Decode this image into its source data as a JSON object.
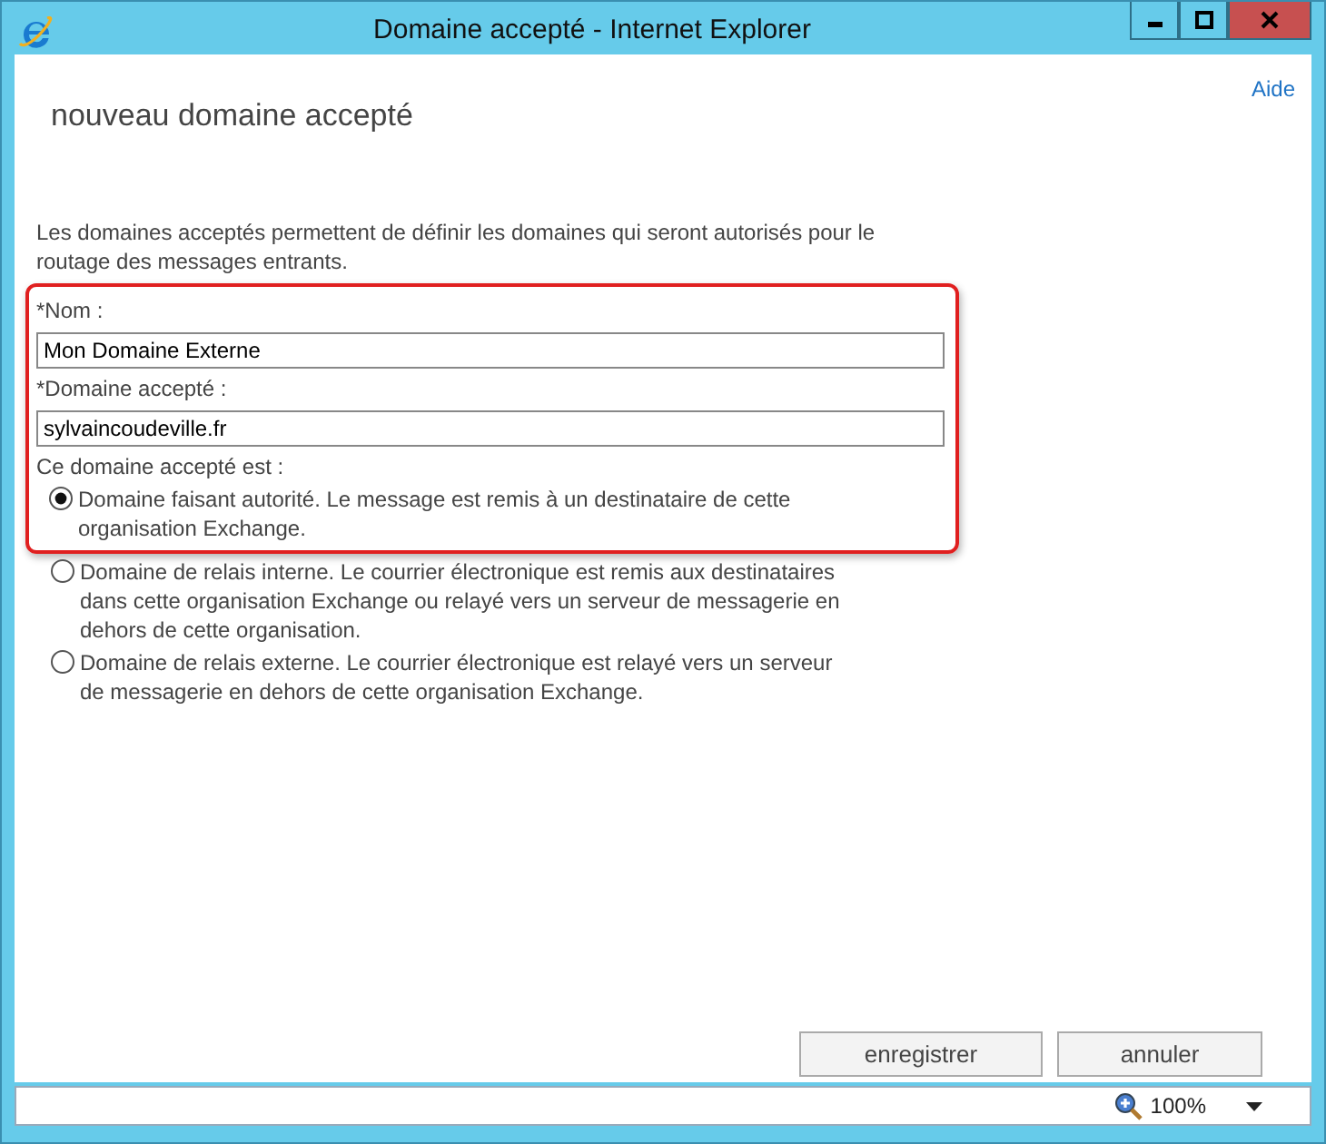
{
  "window": {
    "title": "Domaine accepté - Internet Explorer"
  },
  "help_link": "Aide",
  "heading": "nouveau domaine accepté",
  "description": "Les domaines acceptés permettent de définir les domaines qui seront autorisés pour le routage des messages entrants.",
  "fields": [
    {
      "label": "*Nom :",
      "value": "Mon Domaine Externe"
    },
    {
      "label": "*Domaine accepté :",
      "value": "sylvaincoudeville.fr"
    }
  ],
  "domain_type": {
    "label": "Ce domaine accepté est :",
    "options": [
      {
        "text": "Domaine faisant autorité. Le message est remis à un destinataire de cette organisation Exchange.",
        "selected": true
      },
      {
        "text": "Domaine de relais interne. Le courrier électronique est remis aux destinataires dans cette organisation Exchange ou relayé vers un serveur de messagerie en dehors de cette organisation.",
        "selected": false
      },
      {
        "text": "Domaine de relais externe. Le courrier électronique est relayé vers un serveur de messagerie en dehors de cette organisation Exchange.",
        "selected": false
      }
    ]
  },
  "buttons": [
    "enregistrer",
    "annuler"
  ],
  "status_bar": {
    "zoom": "100%"
  }
}
